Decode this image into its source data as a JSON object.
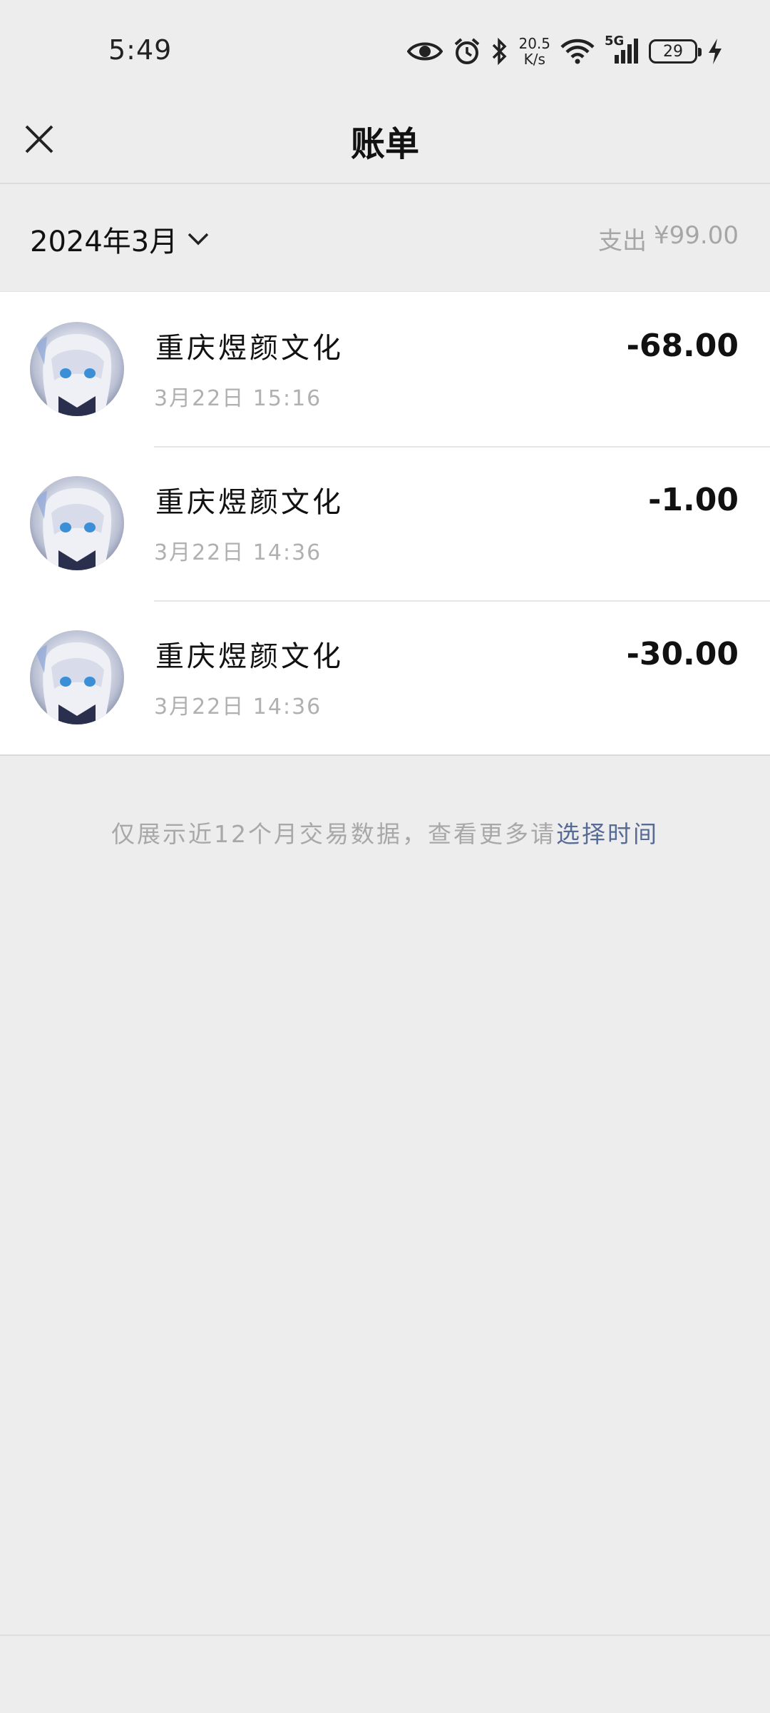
{
  "status_bar": {
    "time": "5:49",
    "net_speed_value": "20.5",
    "net_speed_unit": "K/s",
    "network": "5G",
    "battery": "29",
    "icons": [
      "eye-icon",
      "alarm-icon",
      "bluetooth-icon",
      "wifi-icon",
      "signal-icon",
      "charging-icon"
    ]
  },
  "header": {
    "title": "账单",
    "close_icon": "close-icon"
  },
  "month_bar": {
    "month": "2024年3月",
    "expense_label": "支出",
    "expense_amount": "¥99.00"
  },
  "transactions": [
    {
      "merchant": "重庆煜颜文化",
      "datetime": "3月22日 15:16",
      "amount": "-68.00"
    },
    {
      "merchant": "重庆煜颜文化",
      "datetime": "3月22日 14:36",
      "amount": "-1.00"
    },
    {
      "merchant": "重庆煜颜文化",
      "datetime": "3月22日 14:36",
      "amount": "-30.00"
    }
  ],
  "footer": {
    "note_text": "仅展示近12个月交易数据，查看更多请",
    "note_link": "选择时间"
  },
  "colors": {
    "background": "#ededed",
    "link": "#576b95",
    "muted": "#a6a6a6"
  }
}
